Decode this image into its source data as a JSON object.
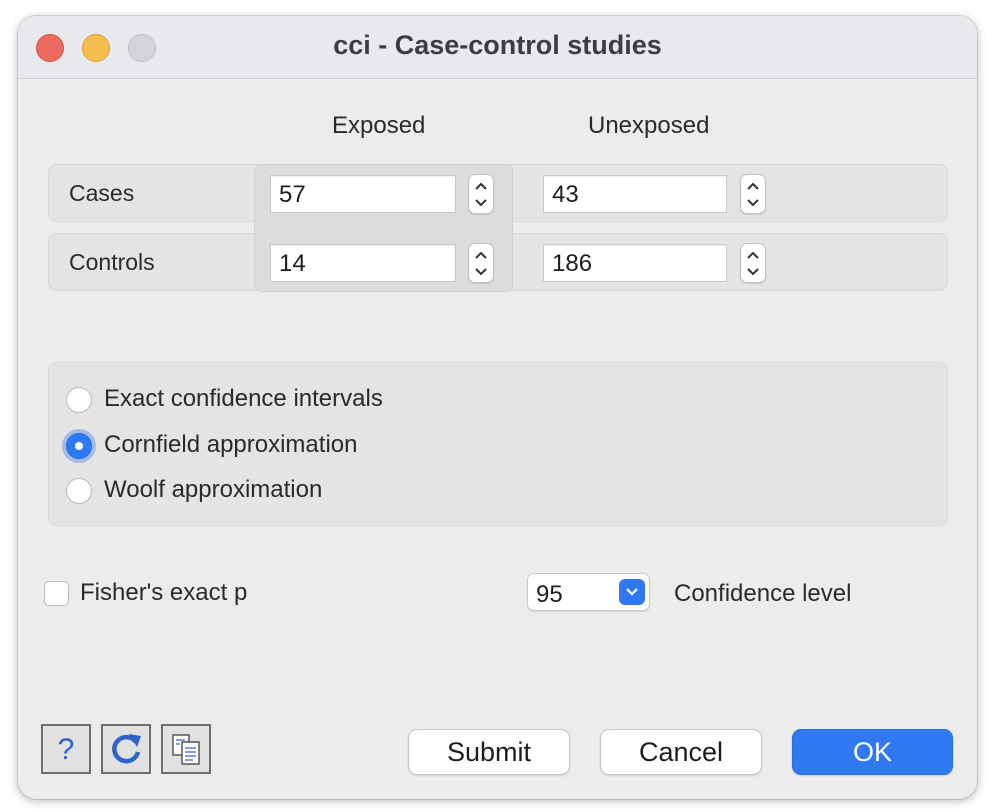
{
  "window": {
    "title": "cci - Case-control studies"
  },
  "table": {
    "columns": [
      "Exposed",
      "Unexposed"
    ],
    "rows": [
      {
        "label": "Cases",
        "exposed": "57",
        "unexposed": "43"
      },
      {
        "label": "Controls",
        "exposed": "14",
        "unexposed": "186"
      }
    ]
  },
  "ci_method": {
    "options": [
      "Exact confidence intervals",
      "Cornfield approximation",
      "Woolf approximation"
    ],
    "selected": "Cornfield approximation"
  },
  "fisher": {
    "label": "Fisher's exact p",
    "checked": false
  },
  "confidence": {
    "value": "95",
    "label": "Confidence level"
  },
  "toolbar": {
    "help_icon": "help-icon",
    "reset_icon": "refresh-icon",
    "copy_icon": "copy-icon"
  },
  "buttons": {
    "submit": "Submit",
    "cancel": "Cancel",
    "ok": "OK"
  },
  "colors": {
    "accent": "#2f7af3",
    "close": "#ed6a5e",
    "minimize": "#f5bf4f",
    "zoom_disabled": "#d4d4d8"
  }
}
